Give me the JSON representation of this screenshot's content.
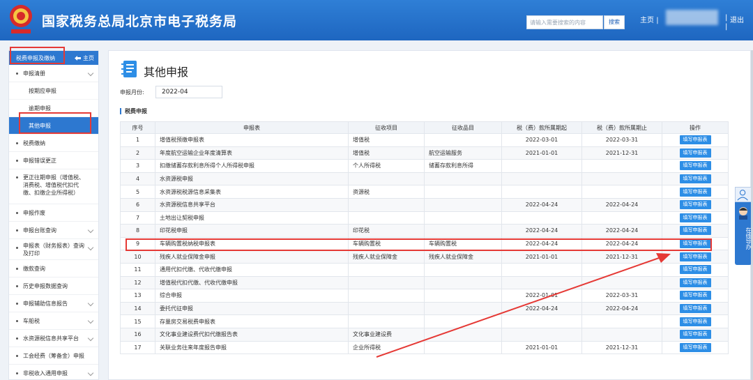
{
  "header": {
    "title": "国家税务总局北京市电子税务局",
    "search_placeholder": "请输入需要搜索的内容",
    "search_button": "搜索",
    "home": "主页",
    "separator": "|",
    "logout": "退出"
  },
  "sidebar": {
    "head_label": "税费申报及缴纳",
    "home_label": "主页",
    "items": [
      {
        "label": "申报清册",
        "expandable": true
      },
      {
        "label": "按期应申报",
        "sub": true
      },
      {
        "label": "逾期申报",
        "sub": true
      },
      {
        "label": "其他申报",
        "sub": true,
        "active": true
      },
      {
        "label": "税费缴纳",
        "expandable": false
      },
      {
        "label": "申报错误更正",
        "expandable": false
      },
      {
        "label": "更正往期申报（增值税、消费税、增值税代扣代缴、扣缴企业所得税）",
        "expandable": false
      },
      {
        "label": "申报作废",
        "expandable": false
      },
      {
        "label": "申报台账查询",
        "expandable": true
      },
      {
        "label": "申报表（财务报表）查询及打印",
        "expandable": true
      },
      {
        "label": "缴款查询",
        "expandable": false
      },
      {
        "label": "历史申报数据查询",
        "expandable": false
      },
      {
        "label": "申报辅助信息报告",
        "expandable": true
      },
      {
        "label": "车船税",
        "expandable": true
      },
      {
        "label": "水资源税信息共享平台",
        "expandable": true
      },
      {
        "label": "工会经费（筹备金）申报",
        "expandable": false
      },
      {
        "label": "非税收入通用申报",
        "expandable": true
      }
    ]
  },
  "main": {
    "page_title": "其他申报",
    "month_label": "申报月份:",
    "month_value": "2022-04",
    "section_title": "税费申报",
    "columns": [
      "序号",
      "申报表",
      "征收项目",
      "征收品目",
      "税（费）款所属期起",
      "税（费）款所属期止",
      "操作"
    ],
    "action_label": "填写申报表",
    "rows": [
      [
        "1",
        "增值税预缴申报表",
        "增值税",
        "",
        "2022-03-01",
        "2022-03-31"
      ],
      [
        "2",
        "年度航空运输企业年度清算表",
        "增值税",
        "航空运输服务",
        "2021-01-01",
        "2021-12-31"
      ],
      [
        "3",
        "扣缴储蓄存款利息所得个人所得税申报",
        "个人所得税",
        "储蓄存款利息所得",
        "",
        ""
      ],
      [
        "4",
        "水资源税申报",
        "",
        "",
        "",
        ""
      ],
      [
        "5",
        "水资源税税源信息采集表",
        "资源税",
        "",
        "",
        ""
      ],
      [
        "6",
        "水资源税信息共享平台",
        "",
        "",
        "2022-04-24",
        "2022-04-24"
      ],
      [
        "7",
        "土地出让契税申报",
        "",
        "",
        "",
        ""
      ],
      [
        "8",
        "印花税申报",
        "印花税",
        "",
        "2022-04-24",
        "2022-04-24"
      ],
      [
        "9",
        "车辆购置税纳税申报表",
        "车辆购置税",
        "车辆购置税",
        "2022-04-24",
        "2022-04-24"
      ],
      [
        "10",
        "残疾人就业保障金申报",
        "残疾人就业保障金",
        "残疾人就业保障金",
        "2021-01-01",
        "2021-12-31"
      ],
      [
        "11",
        "通用代扣代缴、代收代缴申报",
        "",
        "",
        "",
        ""
      ],
      [
        "12",
        "增值税代扣代缴、代收代缴申报",
        "",
        "",
        "",
        ""
      ],
      [
        "13",
        "综合申报",
        "",
        "",
        "2022-01-01",
        "2022-03-31"
      ],
      [
        "14",
        "委托代征申报",
        "",
        "",
        "2022-04-24",
        "2022-04-24"
      ],
      [
        "15",
        "存量房交易税费申报表",
        "",
        "",
        "",
        ""
      ],
      [
        "16",
        "文化事业建设费代扣代缴报告表",
        "文化事业建设费",
        "",
        "",
        ""
      ],
      [
        "17",
        "关联业务往来年度报告申报",
        "企业所得税",
        "",
        "2021-01-01",
        "2021-12-31"
      ]
    ]
  },
  "float_panel": {
    "label": "在线导办"
  },
  "colors": {
    "header": "#2f7fd6",
    "accent": "#2d78d0",
    "annotation": "#e53935"
  }
}
